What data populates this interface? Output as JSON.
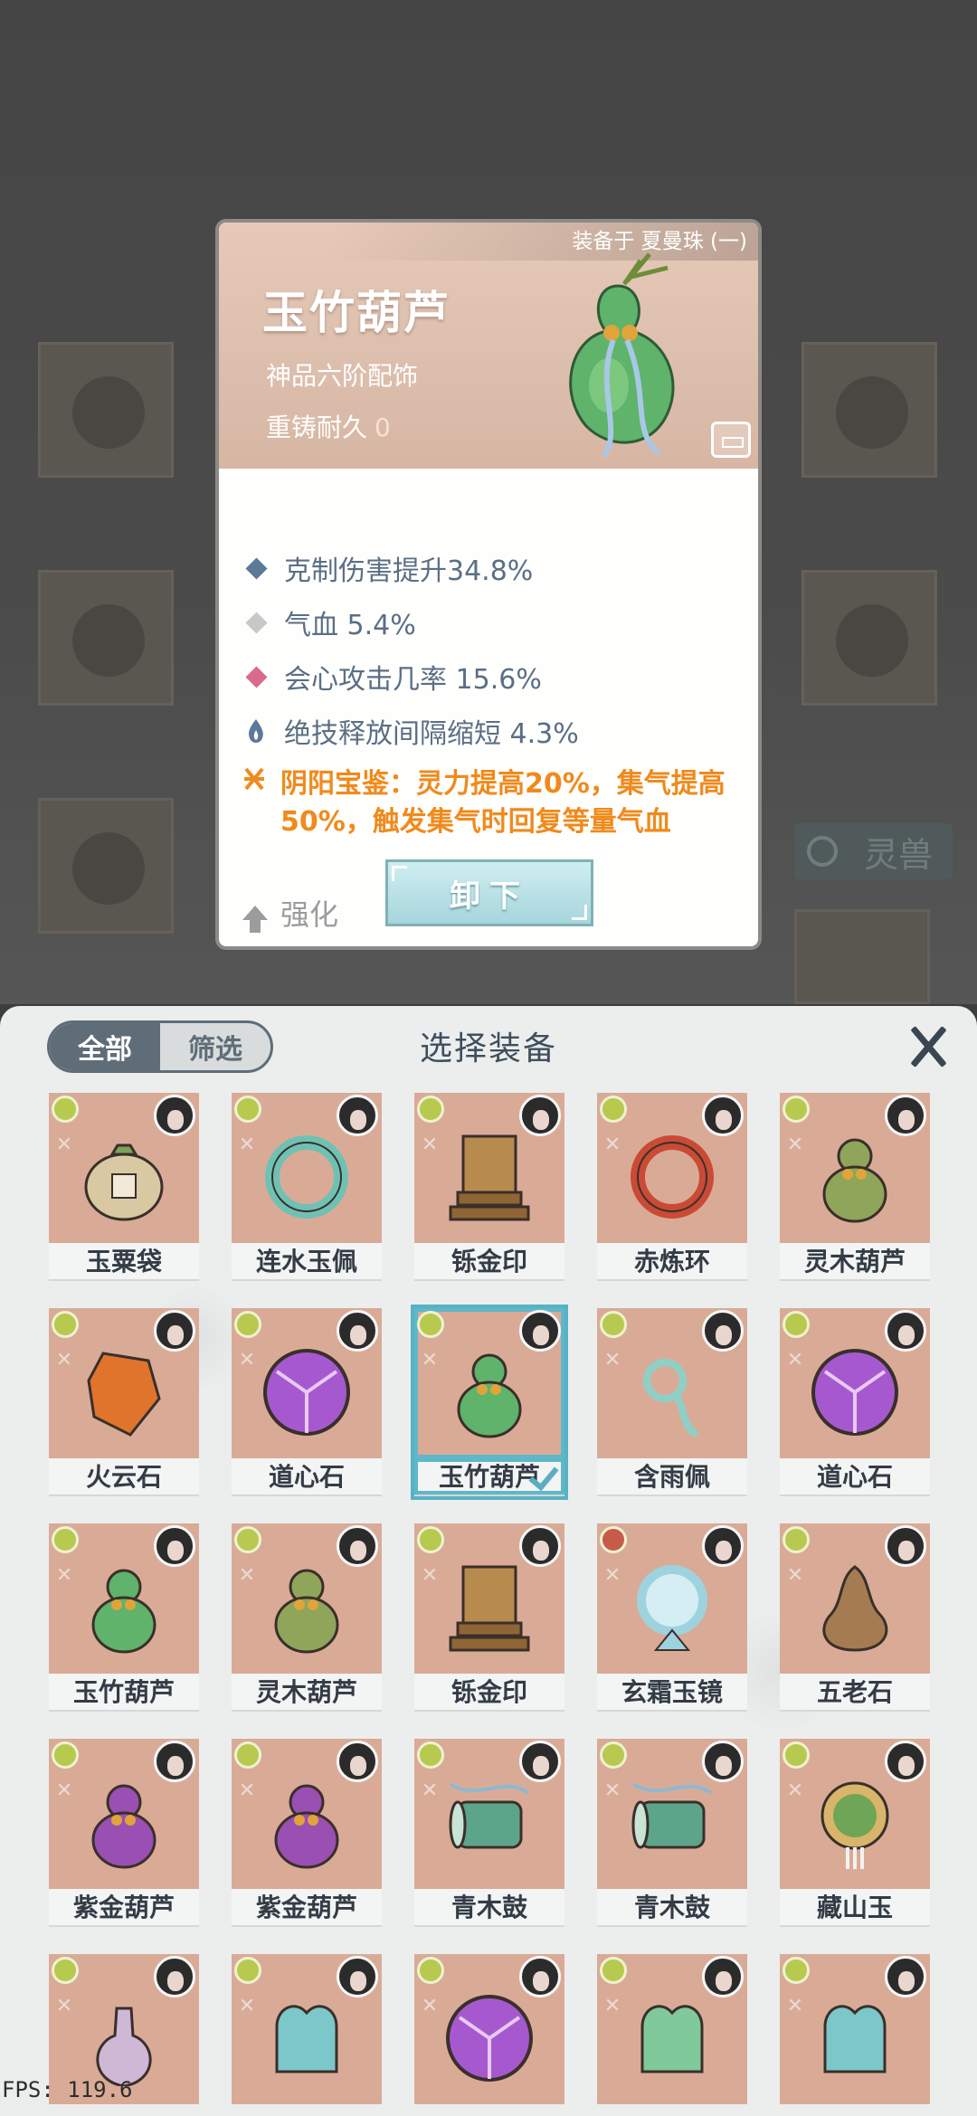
{
  "detail": {
    "equipped_on": "装备于 夏曼珠 (一)",
    "title": "玉竹葫芦",
    "grade": "神品六阶配饰",
    "recast_label": "重铸耐久",
    "recast_value": "0",
    "stats": [
      {
        "text": "克制伤害提升34.8%",
        "icon": "diamond-icon",
        "color": "#5a7a98"
      },
      {
        "text": "气血 5.4%",
        "icon": "diamond-icon",
        "color": "#c8c8c8"
      },
      {
        "text": "会心攻击几率 15.6%",
        "icon": "diamond-icon",
        "color": "#d96a8c"
      },
      {
        "text": "绝技释放间隔缩短 4.3%",
        "icon": "flame-icon",
        "color": "#5a7a98"
      }
    ],
    "special": "阴阳宝鉴：灵力提高20%，集气提高50%，触发集气时回复等量气血",
    "enhance_label": "强化",
    "unequip_label": "卸下"
  },
  "background": {
    "beast_label": "灵兽"
  },
  "panel": {
    "tab_all": "全部",
    "tab_filter": "筛选",
    "title": "选择装备",
    "items": [
      {
        "name": "玉粟袋",
        "art": "bag",
        "color": "#d9c9a2"
      },
      {
        "name": "连水玉佩",
        "art": "ring",
        "color": "#6fc1b4"
      },
      {
        "name": "铄金印",
        "art": "seal",
        "color": "#b78a4e"
      },
      {
        "name": "赤炼环",
        "art": "fire-ring",
        "color": "#c94a35"
      },
      {
        "name": "灵木葫芦",
        "art": "gourd",
        "color": "#8fa55a"
      },
      {
        "name": "火云石",
        "art": "stone",
        "color": "#e0742d"
      },
      {
        "name": "道心石",
        "art": "orb",
        "color": "#a659cf"
      },
      {
        "name": "玉竹葫芦",
        "art": "gourd",
        "color": "#5fb36a",
        "selected": true
      },
      {
        "name": "含雨佩",
        "art": "pendant",
        "color": "#8fd0c6"
      },
      {
        "name": "道心石",
        "art": "orb",
        "color": "#a659cf"
      },
      {
        "name": "玉竹葫芦",
        "art": "gourd",
        "color": "#5fb36a"
      },
      {
        "name": "灵木葫芦",
        "art": "gourd",
        "color": "#8fa55a"
      },
      {
        "name": "铄金印",
        "art": "seal",
        "color": "#b78a4e"
      },
      {
        "name": "玄霜玉镜",
        "art": "mirror",
        "color": "#9dd3df"
      },
      {
        "name": "五老石",
        "art": "rock",
        "color": "#a57c52"
      },
      {
        "name": "紫金葫芦",
        "art": "purple-gourd",
        "color": "#9a4fb2"
      },
      {
        "name": "紫金葫芦",
        "art": "purple-gourd",
        "color": "#9a4fb2"
      },
      {
        "name": "青木鼓",
        "art": "drum",
        "color": "#5da58a"
      },
      {
        "name": "青木鼓",
        "art": "drum",
        "color": "#5da58a"
      },
      {
        "name": "藏山玉",
        "art": "jade",
        "color": "#6fa556"
      },
      {
        "name": "",
        "art": "vase",
        "color": "#cfb7d6"
      },
      {
        "name": "",
        "art": "ornament",
        "color": "#7cc7c9"
      },
      {
        "name": "",
        "art": "orb",
        "color": "#a659cf"
      },
      {
        "name": "",
        "art": "ornament",
        "color": "#7fc99a"
      },
      {
        "name": "",
        "art": "ornament",
        "color": "#7cc7c9"
      }
    ]
  },
  "fps": "FPS: 119.6"
}
